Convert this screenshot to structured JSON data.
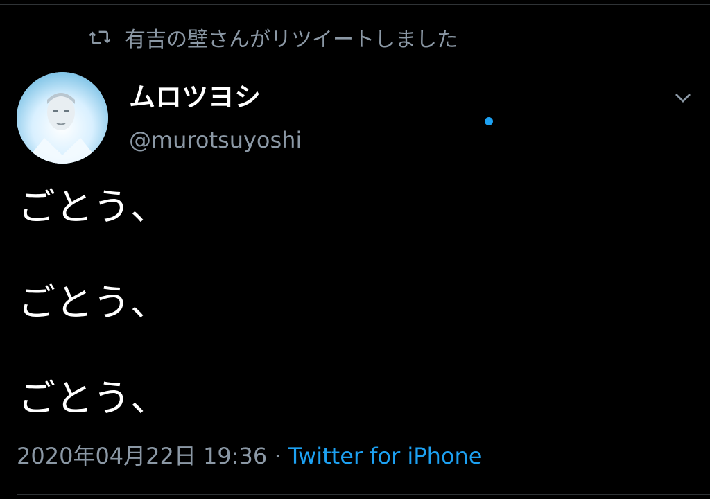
{
  "retweet": {
    "icon": "retweet-icon",
    "text": "有吉の壁さんがリツイートしました"
  },
  "author": {
    "display_name": "ムロツヨシ",
    "handle": "@murotsuyoshi"
  },
  "tweet": {
    "lines": [
      "ごとう、",
      "ごとう、",
      "ごとう、"
    ]
  },
  "meta": {
    "timestamp": "2020年04月22日 19:36",
    "separator": "·",
    "source": "Twitter for iPhone"
  },
  "colors": {
    "background": "#000000",
    "secondary_text": "#8b98a5",
    "link": "#1da1f2",
    "primary_text": "#ffffff"
  }
}
